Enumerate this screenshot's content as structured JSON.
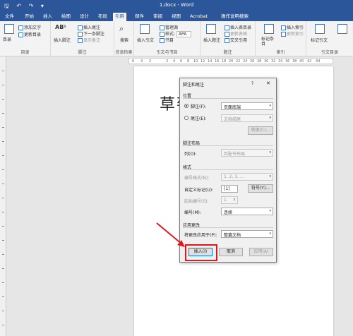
{
  "window": {
    "doc_title": "1.docx - Word"
  },
  "tabs": [
    "文件",
    "开始",
    "插入",
    "绘图",
    "设计",
    "布局",
    "引用",
    "邮件",
    "审阅",
    "视图",
    "Acrobat",
    "操作说明搜索"
  ],
  "ribbon": {
    "toc": {
      "label": "目录",
      "add_text": "添加文字",
      "update": "更新目录",
      "group": "目录"
    },
    "footnote": {
      "insert_footnote": "插入脚注",
      "insert_endnote": "插入尾注",
      "next_footnote": "下一条脚注",
      "show_notes": "显示备注",
      "group": "脚注"
    },
    "search": {
      "label": "搜索",
      "group": "信息检索"
    },
    "citation": {
      "insert_citation": "插入引文",
      "manage": "管理源",
      "style_label": "样式:",
      "style_value": "APA",
      "bibliography": "书目",
      "group": "引文与书目"
    },
    "caption": {
      "insert_caption": "插入题注",
      "insert_table_figures": "插入表目录",
      "update_table": "更新表格",
      "cross_ref": "交叉引用",
      "group": "题注"
    },
    "index": {
      "mark_entry": "标记条目",
      "insert_index": "插入索引",
      "update_index": "更新索引",
      "group": "索引"
    },
    "toa": {
      "mark_citation": "标记引文",
      "group": "引文目录"
    }
  },
  "ruler": [
    "6",
    "4",
    "2",
    "2",
    "4",
    "6",
    "8",
    "10",
    "12",
    "14",
    "16",
    "18",
    "20",
    "22",
    "24",
    "26",
    "28",
    "30",
    "32",
    "34",
    "36",
    "38",
    "40",
    "42",
    "44"
  ],
  "document": {
    "heading": "草莓"
  },
  "dialog": {
    "title": "脚注和尾注",
    "help": "?",
    "close": "✕",
    "location": "位置",
    "footnote_label": "脚注(F):",
    "footnote_value": "页面底端",
    "endnote_label": "尾注(E):",
    "endnote_value": "文档结尾",
    "convert": "转换(C)...",
    "layout": "脚注布局",
    "columns_label": "列(O):",
    "columns_value": "匹配节布局",
    "format": "格式",
    "number_format_label": "编号格式(N):",
    "number_format_value": "1, 2, 3, ...",
    "custom_mark_label": "自定义标记(U):",
    "custom_mark_value": "[1]",
    "symbol": "符号(Y)...",
    "start_at_label": "起始编号(S):",
    "start_at_value": "1",
    "numbering_label": "编号(M):",
    "numbering_value": "连续",
    "apply": "应用更改",
    "apply_to_label": "将更改应用于(P):",
    "apply_to_value": "整篇文档",
    "insert": "插入(I)",
    "cancel": "取消",
    "apply_btn": "应用(A)"
  },
  "colors": {
    "accent": "#2b579a",
    "highlight": "#e0161e"
  }
}
